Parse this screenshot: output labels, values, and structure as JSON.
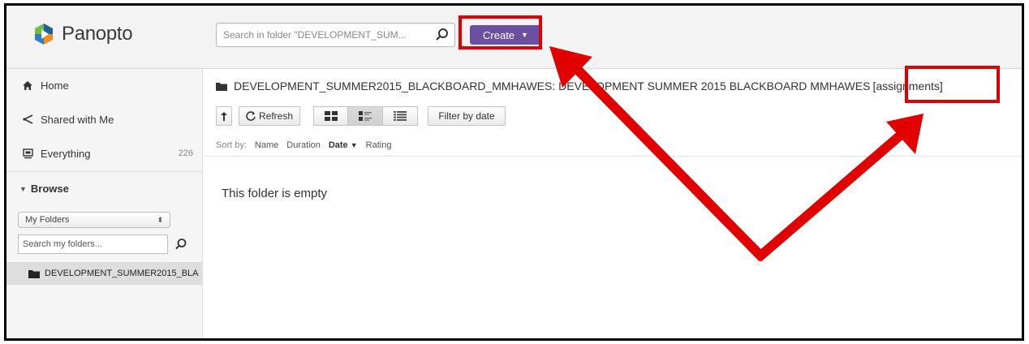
{
  "app": {
    "name": "Panopto",
    "colors": {
      "accent": "#6b4fa1",
      "annotation": "#e00000",
      "logo_green": "#6fbf3f",
      "logo_blue": "#2e7dc3",
      "logo_orange": "#f28c1e"
    }
  },
  "header": {
    "search_placeholder": "Search in folder \"DEVELOPMENT_SUM...",
    "search_icon": "search-icon",
    "create_label": "Create",
    "create_caret": "▼"
  },
  "sidebar": {
    "items": [
      {
        "label": "Home",
        "icon": "home-icon"
      },
      {
        "label": "Shared with Me",
        "icon": "share-icon"
      },
      {
        "label": "Everything",
        "icon": "everything-icon",
        "count": "226"
      }
    ],
    "browse_label": "Browse",
    "folder_select_value": "My Folders",
    "folder_search_placeholder": "Search my folders...",
    "folder_name": "DEVELOPMENT_SUMMER2015_BLA"
  },
  "main": {
    "folder_title": "DEVELOPMENT_SUMMER2015_BLACKBOARD_MMHAWES: DEVELOPMENT SUMMER 2015 BLACKBOARD MMHAWES",
    "folder_tag": "[assignments]",
    "toolbar": {
      "refresh_label": "Refresh",
      "filter_label": "Filter by date"
    },
    "sort": {
      "prefix": "Sort by:",
      "options": [
        "Name",
        "Duration",
        "Date",
        "Rating"
      ],
      "active": "Date",
      "active_caret": "▼"
    },
    "empty_message": "This folder is empty"
  }
}
